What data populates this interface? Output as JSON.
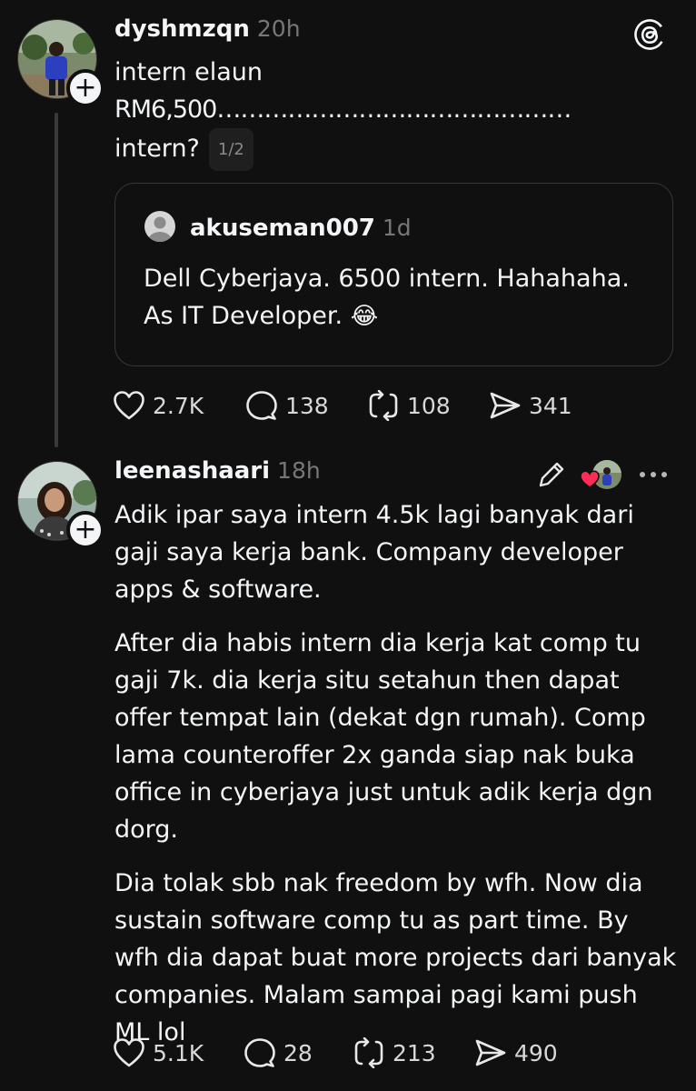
{
  "post1": {
    "username": "dyshmzqn",
    "time": "20h",
    "text_line1": "intern elaun",
    "text_line2": "RM6,500………………………………………",
    "text_line3": "intern?",
    "pager": "1/2",
    "quote": {
      "username": "akuseman007",
      "time": "1d",
      "line1": "Dell Cyberjaya. 6500 intern. Hahahaha.",
      "line2": "As IT Developer.",
      "emoji": "😂"
    },
    "likes": "2.7K",
    "replies": "138",
    "reposts": "108",
    "shares": "341"
  },
  "post2": {
    "username": "leenashaari",
    "time": "18h",
    "paragraphs": [
      "Adik ipar saya intern 4.5k lagi banyak dari gaji saya kerja bank. Company developer apps & software.",
      "After dia habis intern dia kerja kat comp tu gaji 7k. dia kerja situ setahun then dapat offer tempat lain (dekat dgn rumah). Comp lama counteroffer 2x ganda siap nak buka office in cyberjaya just untuk adik kerja dgn dorg.",
      "Dia tolak sbb nak freedom by wfh. Now dia sustain software comp tu as part time. By wfh dia dapat buat more projects dari banyak companies. Malam sampai pagi kami push ML lol"
    ],
    "likes": "5.1K",
    "replies": "28",
    "reposts": "213",
    "shares": "490"
  },
  "icons": {
    "threads_logo": "threads-logo-icon",
    "like": "heart-icon",
    "reply": "speech-bubble-icon",
    "repost": "repost-arrows-icon",
    "share": "paper-plane-icon",
    "edit": "pencil-icon",
    "more": "ellipsis-icon",
    "follow": "plus-icon"
  },
  "colors": {
    "background": "#101010",
    "text": "#f3f5f7",
    "muted": "#777777",
    "like_heart": "#ff2d55"
  }
}
